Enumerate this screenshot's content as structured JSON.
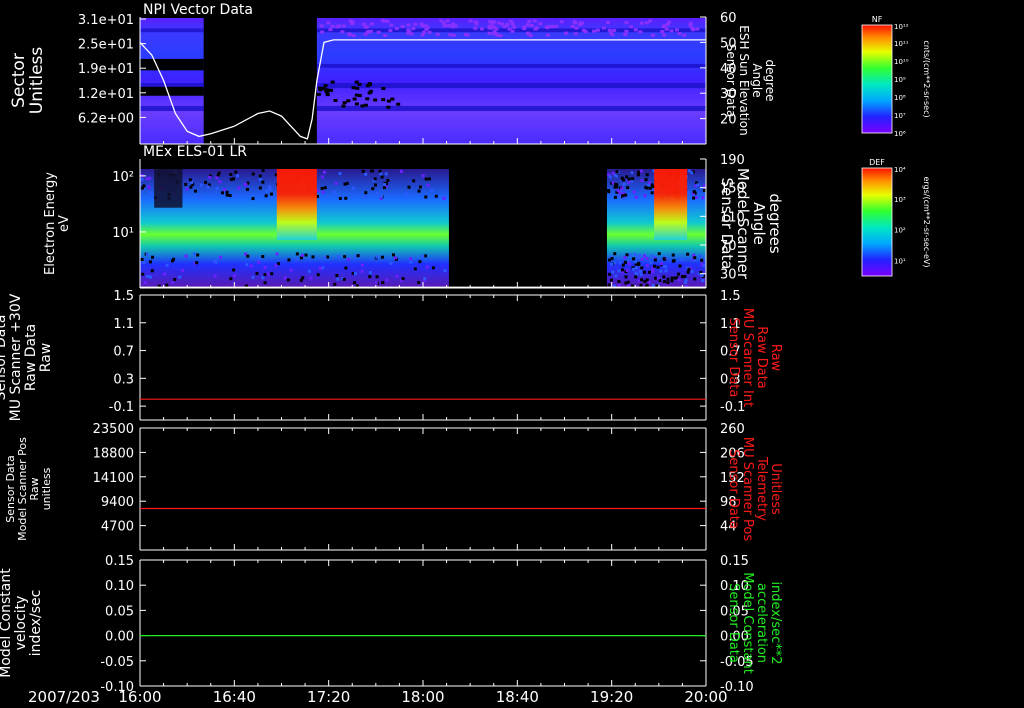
{
  "figure": {
    "date_label": "2007/203"
  },
  "colors": {
    "axis": "#ffffff",
    "red": "#ff1a1a",
    "green": "#22ee22",
    "sun": "#ffffff"
  },
  "time_axis": {
    "tick_labels": [
      "16:00",
      "16:40",
      "17:20",
      "18:00",
      "18:40",
      "19:20",
      "20:00"
    ],
    "range_min": [
      960,
      1200
    ]
  },
  "colorbars": [
    {
      "title": "NF",
      "top_label": "10¹²",
      "labels": [
        "10¹¹",
        "10¹⁰",
        "10⁹",
        "10⁸",
        "10⁷",
        "10⁶"
      ],
      "unit": "cnts/(cm**2-sr-sec)"
    },
    {
      "title": "DEF",
      "top_label": "10⁴",
      "labels": [
        "10³",
        "10²",
        "10¹"
      ],
      "unit": "ergs/(cm**2-sr-sec-eV)"
    }
  ],
  "chart_data": [
    {
      "type": "heatmap",
      "title": "NPI Vector Data",
      "ylabel": [
        "Sector",
        "Unitless"
      ],
      "yticks": [
        "3.1e+01",
        "2.5e+01",
        "1.9e+01",
        "1.2e+01",
        "6.2e+00"
      ],
      "y2label": [
        "Sensor Data",
        "ESH Sun Elevation",
        "Angle",
        "degree"
      ],
      "y2ticks": [
        "60",
        "50",
        "40",
        "30",
        "20"
      ],
      "y2lim": [
        10,
        60
      ],
      "coverage_min": [
        [
          960,
          987
        ],
        [
          1035,
          1200
        ]
      ],
      "line": {
        "name": "ESH Sun Elevation Angle",
        "x_min": [
          960,
          965,
          970,
          975,
          980,
          985,
          990,
          1000,
          1010,
          1015,
          1020,
          1025,
          1028,
          1031,
          1033,
          1035,
          1038,
          1042,
          1200
        ],
        "y_deg": [
          50,
          45,
          35,
          22,
          15,
          13,
          14,
          17,
          22,
          23,
          21,
          16,
          13,
          12,
          20,
          35,
          50,
          51,
          51
        ]
      }
    },
    {
      "type": "heatmap",
      "title": "MEx ELS-01 LR",
      "ylabel": [
        "Electron Energy",
        "eV"
      ],
      "yticks": [
        "10²",
        "10¹"
      ],
      "ylim": [
        1,
        200
      ],
      "yscale": "log",
      "y2label": [
        "Sensor Data",
        "Model Scanner",
        "Angle",
        "degrees"
      ],
      "y2ticks": [
        "190",
        "150",
        "110",
        "70",
        "30"
      ],
      "y2lim": [
        10,
        190
      ],
      "coverage_min": [
        [
          960,
          1091
        ],
        [
          1158,
          1200
        ]
      ],
      "hot_intervals_min": [
        [
          1018,
          1035
        ],
        [
          1178,
          1192
        ]
      ],
      "line": {
        "name": "Model Scanner Angle",
        "x_min": [
          960,
          1200
        ],
        "y_deg": [
          11,
          11
        ]
      }
    },
    {
      "type": "line",
      "ylabel": [
        "Sensor Data",
        "MU Scanner +30V",
        "Raw Data",
        "Raw"
      ],
      "yticks": [
        "1.5",
        "1.1",
        "0.7",
        "0.3",
        "-0.1"
      ],
      "ylim": [
        -0.3,
        1.5
      ],
      "y2label": [
        "Sensor Data",
        "MU Scanner Int",
        "Raw Data",
        "Raw"
      ],
      "y2ticks": [
        "1.5",
        "1.1",
        "0.7",
        "0.3",
        "-0.1"
      ],
      "series": [
        {
          "x_min": [
            960,
            1200
          ],
          "values": [
            0.0,
            0.0
          ],
          "color": "#ff1a1a"
        }
      ]
    },
    {
      "type": "line",
      "ylabel": [
        "Sensor Data",
        "Model Scanner Pos",
        "Raw",
        "unitless"
      ],
      "yticks": [
        "23500",
        "18800",
        "14100",
        "9400",
        "4700"
      ],
      "ylim": [
        0,
        23500
      ],
      "y2label": [
        "Sensor Data",
        "MU Scanner Pos",
        "Telemetry",
        "Unitless"
      ],
      "y2ticks": [
        "260",
        "206",
        "152",
        "98",
        "44"
      ],
      "series": [
        {
          "x_min": [
            960,
            1200
          ],
          "values": [
            8000,
            8000
          ],
          "color": "#ff1a1a"
        }
      ]
    },
    {
      "type": "line",
      "ylabel": [
        "Sensor Data",
        "Model Constant",
        "velocity",
        "index/sec"
      ],
      "yticks": [
        "0.15",
        "0.10",
        "0.05",
        "0.00",
        "-0.05",
        "-0.10"
      ],
      "ylim": [
        -0.1,
        0.15
      ],
      "y2label": [
        "Sensor Data",
        "Model Constant",
        "acceleration",
        "index/sec**2"
      ],
      "y2ticks": [
        "0.15",
        "0.10",
        "0.05",
        "0.00",
        "-0.05",
        "-0.10"
      ],
      "series": [
        {
          "x_min": [
            960,
            1200
          ],
          "values": [
            0.0,
            0.0
          ],
          "color": "#22ee22"
        }
      ]
    }
  ]
}
